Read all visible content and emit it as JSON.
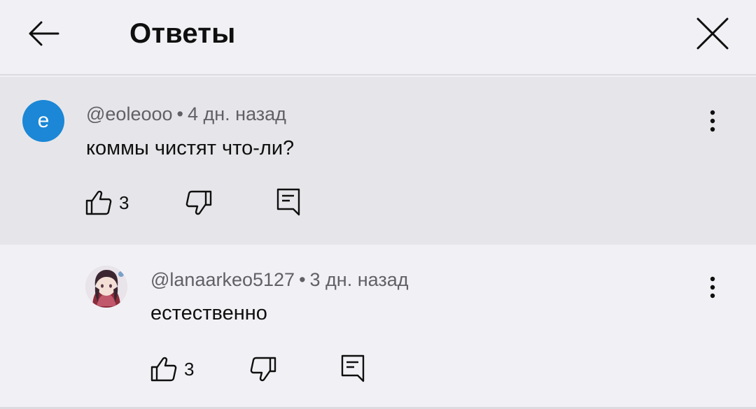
{
  "header": {
    "title": "Ответы"
  },
  "comments": [
    {
      "avatar_letter": "e",
      "avatar_color": "#1b87d6",
      "author": "@eoleooo",
      "separator": "•",
      "time": "4 дн. назад",
      "text": "коммы чистят что-ли?",
      "likes": "3"
    },
    {
      "avatar_letter": "",
      "author": "@lanaarkeo5127",
      "separator": "•",
      "time": "3 дн. назад",
      "text": "естественно",
      "likes": "3"
    }
  ],
  "icons": {
    "back": "arrow-left-icon",
    "close": "close-icon",
    "more": "more-vert-icon",
    "like": "thumb-up-icon",
    "dislike": "thumb-down-icon",
    "reply": "comment-reply-icon"
  }
}
